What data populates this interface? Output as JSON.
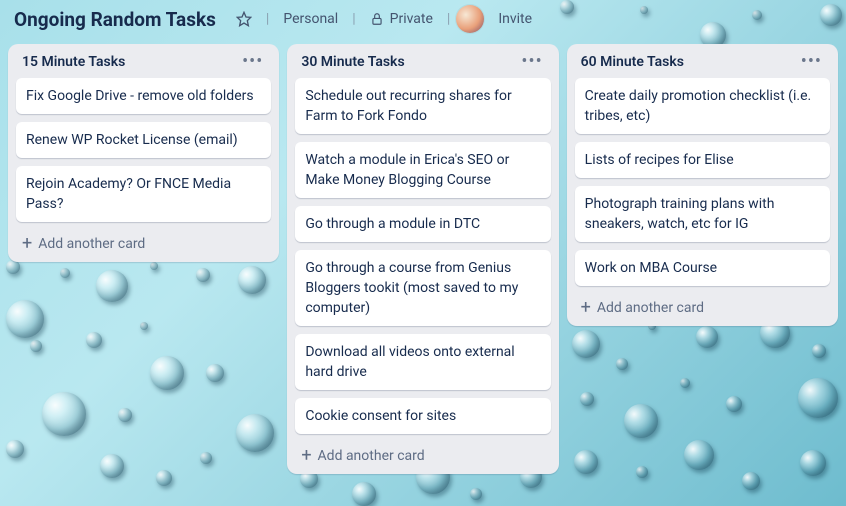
{
  "header": {
    "title": "Ongoing Random Tasks",
    "personal_label": "Personal",
    "private_label": "Private",
    "invite_label": "Invite"
  },
  "add_card_label": "Add another card",
  "lists": [
    {
      "title": "15 Minute Tasks",
      "cards": [
        "Fix Google Drive - remove old folders",
        "Renew WP Rocket License (email)",
        "Rejoin Academy? Or FNCE Media Pass?"
      ]
    },
    {
      "title": "30 Minute Tasks",
      "cards": [
        "Schedule out recurring shares for Farm to Fork Fondo",
        "Watch a module in Erica's SEO or Make Money Blogging Course",
        "Go through a module in DTC",
        "Go through a course from Genius Bloggers tookit (most saved to my computer)",
        "Download all videos onto external hard drive",
        "Cookie consent for sites"
      ]
    },
    {
      "title": "60 Minute Tasks",
      "cards": [
        "Create daily promotion checklist (i.e. tribes, etc)",
        "Lists of recipes for Elise",
        "Photograph training plans with sneakers, watch, etc for IG",
        "Work on MBA Course"
      ]
    }
  ]
}
